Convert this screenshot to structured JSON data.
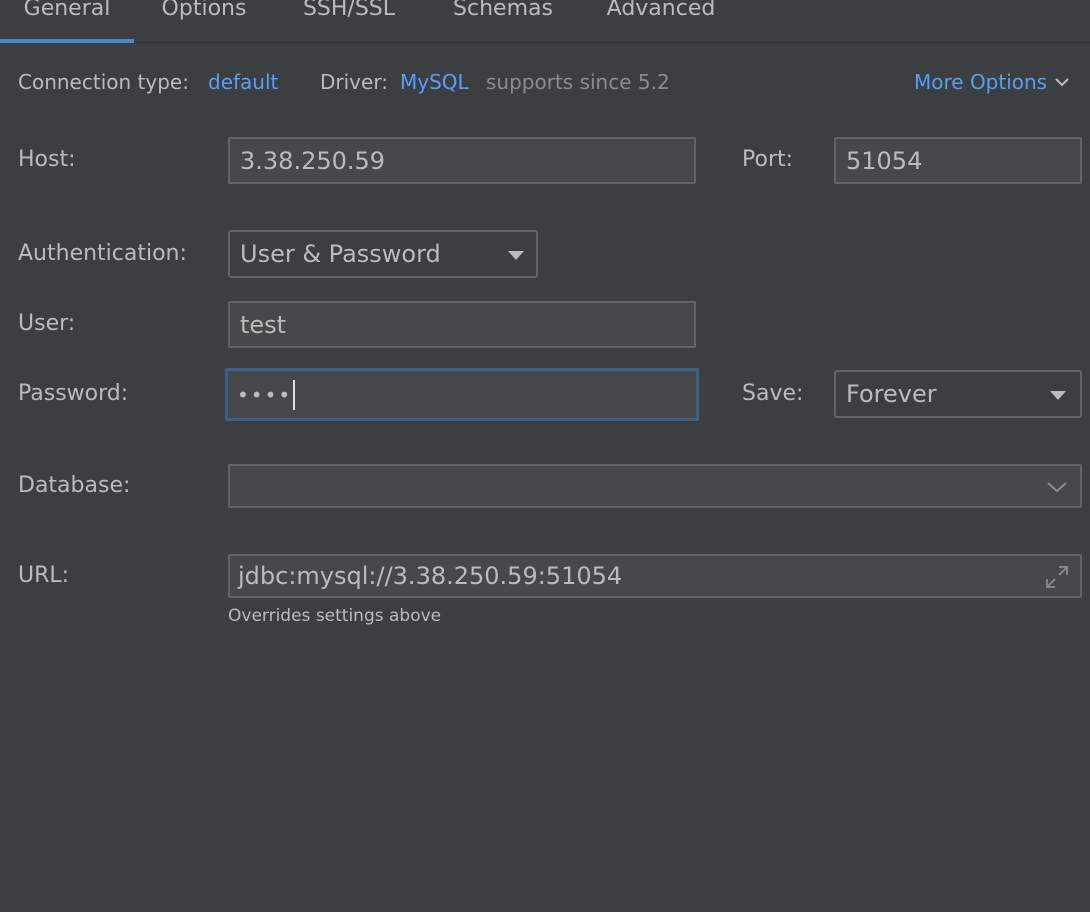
{
  "tabs": [
    {
      "label": "General",
      "active": true
    },
    {
      "label": "Options",
      "active": false
    },
    {
      "label": "SSH/SSL",
      "active": false
    },
    {
      "label": "Schemas",
      "active": false
    },
    {
      "label": "Advanced",
      "active": false
    }
  ],
  "info_row": {
    "connection_type_label": "Connection type:",
    "connection_type_value": "default",
    "driver_label": "Driver:",
    "driver_value": "MySQL",
    "driver_note": "supports since 5.2",
    "more_options": "More Options"
  },
  "host": {
    "label": "Host:",
    "value": "3.38.250.59"
  },
  "port": {
    "label": "Port:",
    "value": "51054"
  },
  "authentication": {
    "label": "Authentication:",
    "value": "User & Password"
  },
  "user": {
    "label": "User:",
    "value": "test"
  },
  "password": {
    "label": "Password:",
    "masked_value": "••••"
  },
  "save": {
    "label": "Save:",
    "value": "Forever"
  },
  "database": {
    "label": "Database:",
    "value": ""
  },
  "url": {
    "label": "URL:",
    "value": "jdbc:mysql://3.38.250.59:51054",
    "hint": "Overrides settings above"
  },
  "colors": {
    "background": "#3c3f41",
    "accent": "#4a88c7",
    "link": "#589df6",
    "field_bg": "#45494a",
    "border": "#646464",
    "focus_border": "#3d6185"
  },
  "icons": [
    "chevron-down-icon",
    "dropdown-arrow-icon",
    "expand-icon",
    "text-cursor"
  ]
}
